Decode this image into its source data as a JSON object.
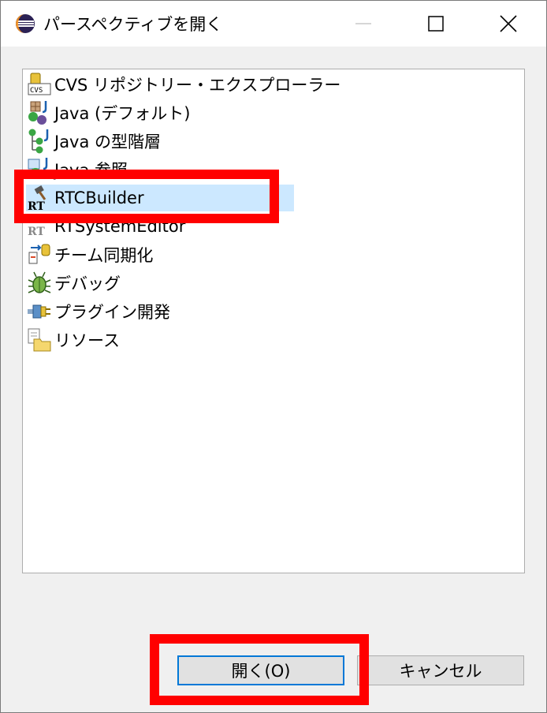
{
  "window": {
    "title": "パースペクティブを開く"
  },
  "list": {
    "items": [
      {
        "label": "CVS リポジトリー・エクスプローラー",
        "icon": "cvs-repository-icon"
      },
      {
        "label": "Java (デフォルト)",
        "icon": "java-perspective-icon"
      },
      {
        "label": "Java の型階層",
        "icon": "java-type-hierarchy-icon"
      },
      {
        "label": "Java 参照",
        "icon": "java-browsing-icon"
      },
      {
        "label": "RTCBuilder",
        "icon": "rtcbuilder-icon",
        "selected": true
      },
      {
        "label": "RTSystemEditor",
        "icon": "rtsystemeditor-icon"
      },
      {
        "label": "チーム同期化",
        "icon": "team-synchronize-icon"
      },
      {
        "label": "デバッグ",
        "icon": "debug-bug-icon"
      },
      {
        "label": "プラグイン開発",
        "icon": "plugin-development-icon"
      },
      {
        "label": "リソース",
        "icon": "resource-folder-icon"
      }
    ]
  },
  "buttons": {
    "open_label": "開く(O)",
    "cancel_label": "キャンセル"
  },
  "colors": {
    "selection": "#cce8ff",
    "highlight": "#ff0000",
    "default_button_border": "#0078d7"
  }
}
